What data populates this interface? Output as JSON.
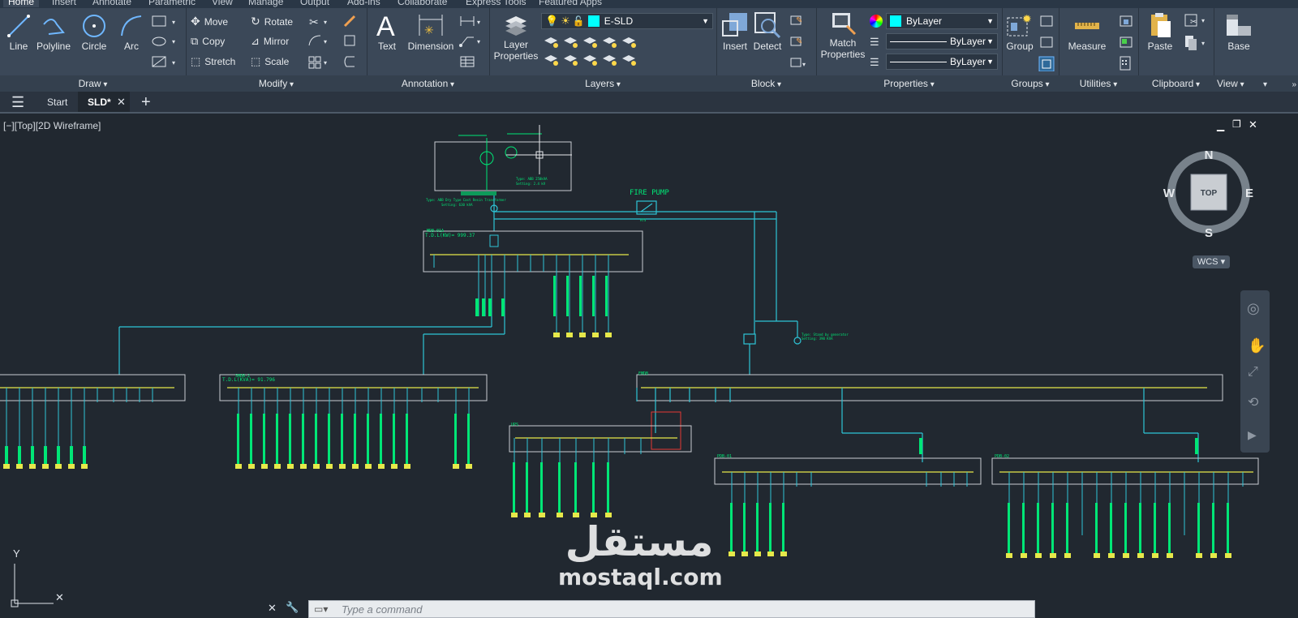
{
  "menu_tabs": [
    "Home",
    "Insert",
    "Annotate",
    "Parametric",
    "View",
    "Manage",
    "Output",
    "Add-ins",
    "Collaborate",
    "Express Tools",
    "Featured Apps"
  ],
  "ribbon": {
    "draw": {
      "title": "Draw",
      "line": "Line",
      "polyline": "Polyline",
      "circle": "Circle",
      "arc": "Arc"
    },
    "modify": {
      "title": "Modify",
      "move": "Move",
      "rotate": "Rotate",
      "copy": "Copy",
      "mirror": "Mirror",
      "stretch": "Stretch",
      "scale": "Scale"
    },
    "annotation": {
      "title": "Annotation",
      "text": "Text",
      "dimension": "Dimension"
    },
    "layers": {
      "title": "Layers",
      "layer_properties_1": "Layer",
      "layer_properties_2": "Properties",
      "current_layer": "E-SLD",
      "layer_color": "#00ffff"
    },
    "block": {
      "title": "Block",
      "insert": "Insert",
      "detect": "Detect"
    },
    "properties": {
      "title": "Properties",
      "match_1": "Match",
      "match_2": "Properties",
      "color": "ByLayer",
      "linetype": "ByLayer",
      "lineweight": "ByLayer"
    },
    "groups": {
      "title": "Groups",
      "group": "Group"
    },
    "utilities": {
      "title": "Utilities",
      "measure": "Measure"
    },
    "clipboard": {
      "title": "Clipboard",
      "paste": "Paste"
    },
    "view": {
      "title": "View",
      "base": "Base"
    }
  },
  "doc_tabs": {
    "start": "Start",
    "sld": "SLD*"
  },
  "viewport": {
    "label": "[−][Top][2D Wireframe]",
    "compass": {
      "n": "N",
      "s": "S",
      "e": "E",
      "w": "W",
      "top": "TOP"
    },
    "wcs": "WCS",
    "ucs_y": "Y"
  },
  "drawing": {
    "fire_pump": "FIRE PUMP",
    "mdb_label": "MDB-01A",
    "mdb_td": "T.D.L(KW)= 999.37",
    "smdb2_label": "SMDB-2",
    "smdb2_td": "T.D.L(KVA)= 91.796",
    "emdb_label": "EMDB",
    "ups_label": "UPS",
    "pdb_label_1": "PDB-01",
    "pdb_label_2": "PDB-02",
    "ats": "ATS"
  },
  "command": {
    "placeholder": "Type a command"
  },
  "watermark": {
    "arabic": "مستقل",
    "latin": "mostaql.com"
  }
}
